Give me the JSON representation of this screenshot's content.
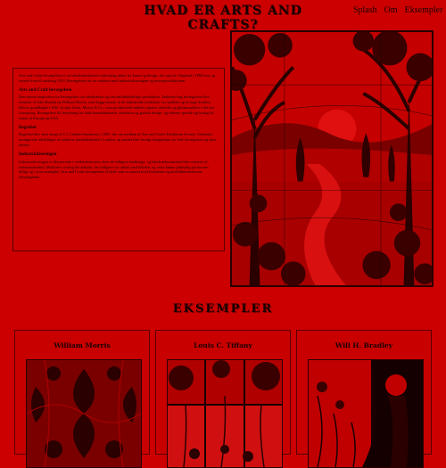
{
  "page": {
    "title": "HVAD ER ARTS AND CRAFTS?"
  },
  "nav": {
    "items": [
      "Splash",
      "Om",
      "Eksempler"
    ]
  },
  "intro": {
    "paragraph": "Arts and Crafts bevægelsen er en håndværksbaseret stilretning inden for kunst og design, der opstod i England i 1860'erne og varede frem til omkring 1910. Bevægelsen var en reaktion mod industrialiseringen og masseproduktionen."
  },
  "sections": [
    {
      "heading": "Arts and Craft bevægelsen",
      "body": "Den største inspiration for bevægelsen var håndværket og den middelalderlige produktion. Tankerne bag bevægelsen blev fremført af John Ruskin og William Morris, som begge mente, at de industrielle produkter var sjælløse og af ringe kvalitet. Morris grundlagde i 1861 sit eget firma, Morris & Co., som producerede møbler, tapeter, tekstiler og glasmosaikker i det nye formsprog. Bevægelsen fik betydning for både kunsthåndværk, arkitektur og grafisk design, og idéerne spredte sig hurtigt til resten af Europa og USA."
    },
    {
      "heading": "Begrebet",
      "body": "Begrebet blev først brugt af T.J. Cobden-Sanderson i 1887, der var medlem af Arts and Crafts Exhibition Society. Selskabet arrangerede udstillinger af moderne kunsthåndværk i London, og navnet blev hurtigt betegnelsen for hele bevægelsen og dens idealer."
    },
    {
      "heading": "Industrialiseringen",
      "body": "Industrialiseringen er den periode i verdenshistorien, hvor de tidligere landbrugs- og håndværkssamfund blev erstattet af industrisamfund. Maskiner overtog det arbejde, der tidligere var udført med hånden, og varer kunne pludselig produceres billigt og i store mængder. Arts and Crafts bevægelsen så dette som en trussel mod kvaliteten og mod håndværkerens arbejdsglæde."
    }
  ],
  "examples": {
    "heading": "EKSEMPLER",
    "cards": [
      {
        "name": "William Morris"
      },
      {
        "name": "Louis C. Tiffany"
      },
      {
        "name": "Will H. Bradley"
      }
    ]
  },
  "colors": {
    "background": "#cc0000",
    "text": "#1a0000",
    "border": "#5a0000"
  }
}
